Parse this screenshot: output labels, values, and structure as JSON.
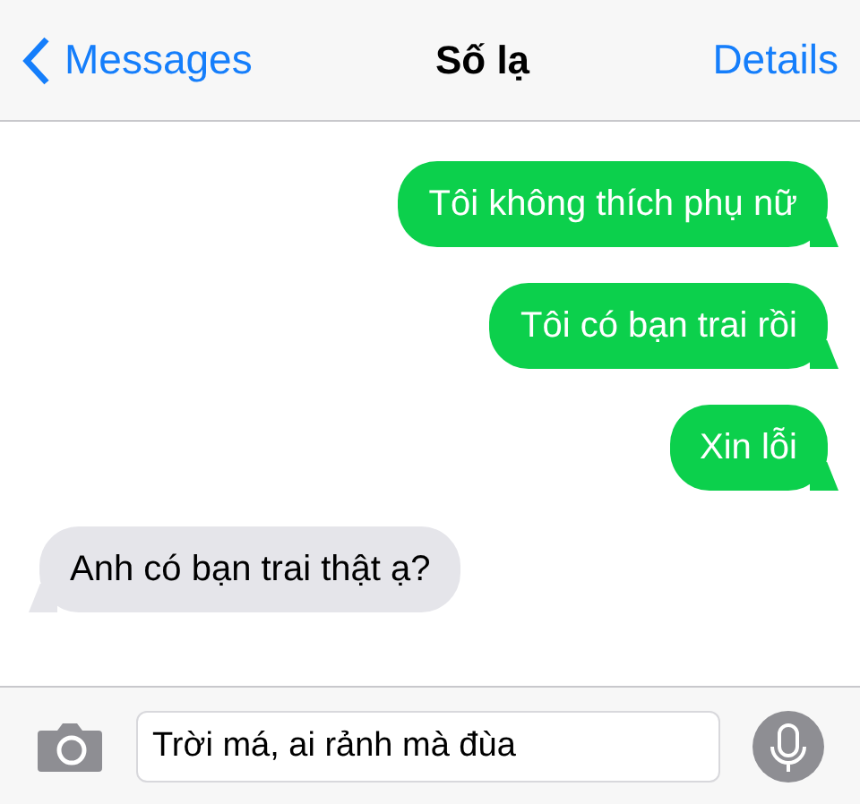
{
  "header": {
    "back": "Messages",
    "title": "Số lạ",
    "action": "Details"
  },
  "messages": [
    {
      "kind": "sent",
      "text": "Tôi không thích phụ nữ"
    },
    {
      "kind": "sent",
      "text": "Tôi có bạn trai rồi"
    },
    {
      "kind": "sent",
      "text": "Xin lỗi"
    },
    {
      "kind": "received",
      "text": "Anh có bạn trai thật ạ?"
    }
  ],
  "composer": {
    "value": "Trời má, ai rảnh mà đùa"
  }
}
